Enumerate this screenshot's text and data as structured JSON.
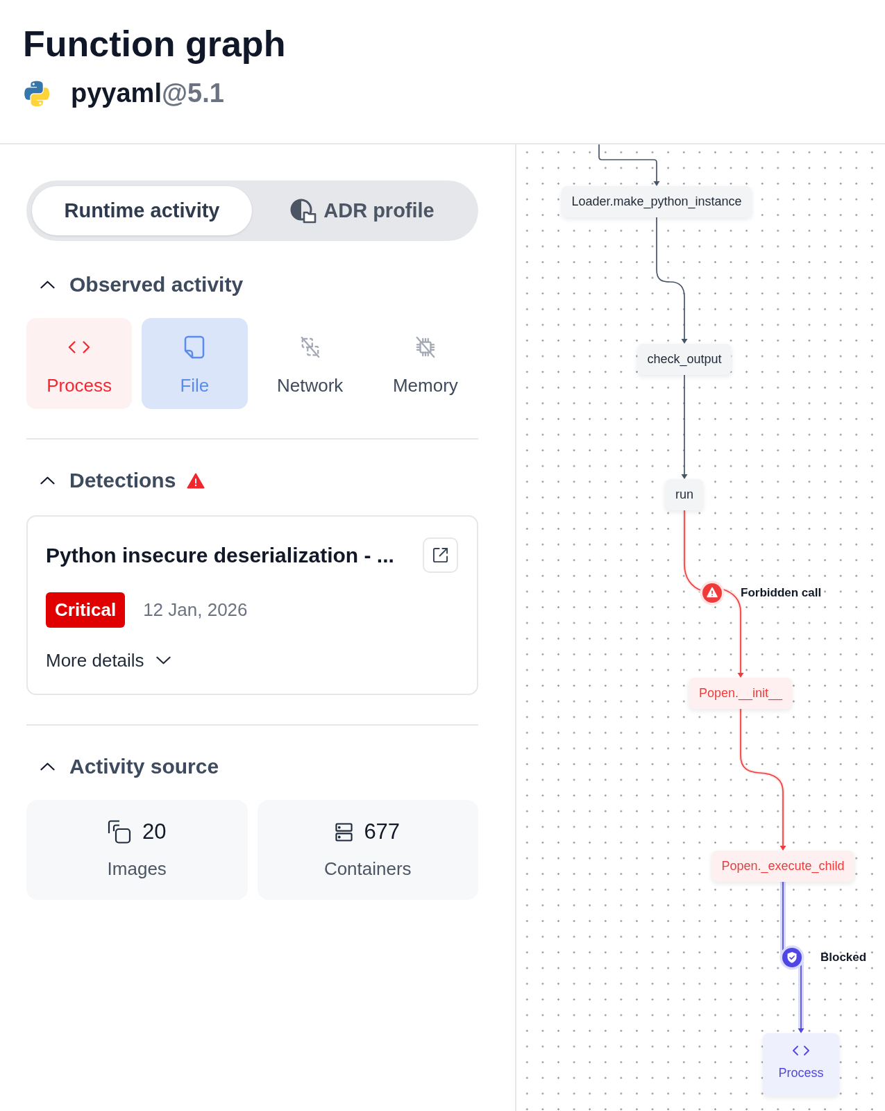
{
  "header": {
    "title": "Function graph",
    "package": {
      "name": "pyyaml",
      "version": "@5.1"
    }
  },
  "tabs": [
    {
      "label": "Runtime activity",
      "selected": true,
      "icon": false
    },
    {
      "label": "ADR profile",
      "selected": false,
      "icon": true
    }
  ],
  "observed_activity": {
    "title": "Observed activity",
    "expanded": true,
    "items": [
      {
        "kind": "process",
        "label": "Process",
        "observed": true,
        "alert": true
      },
      {
        "kind": "file",
        "label": "File",
        "observed": true,
        "alert": false
      },
      {
        "kind": "network",
        "label": "Network",
        "observed": false,
        "alert": false
      },
      {
        "kind": "memory",
        "label": "Memory",
        "observed": false,
        "alert": false
      }
    ]
  },
  "detections": {
    "title": "Detections",
    "alert": true,
    "expanded": true,
    "items": [
      {
        "title": "Python insecure deserialization - ...",
        "severity": {
          "kind": "critical",
          "label": "Critical"
        },
        "date": "12 Jan, 2026",
        "details_label": "More details",
        "details_expanded": false
      }
    ]
  },
  "activity_source": {
    "title": "Activity source",
    "expanded": true,
    "items": [
      {
        "kind": "images",
        "count": "20",
        "label": "Images"
      },
      {
        "kind": "containers",
        "count": "677",
        "label": "Containers"
      }
    ]
  },
  "graph": {
    "nodes": [
      {
        "kind": "function",
        "label": "Loader.make_python_instance",
        "forbidden": false,
        "blocked": false
      },
      {
        "kind": "function",
        "label": "check_output",
        "forbidden": false,
        "blocked": false
      },
      {
        "kind": "function",
        "label": "run",
        "forbidden": false,
        "blocked": false
      },
      {
        "kind": "function",
        "label": "Popen.__init__",
        "forbidden": true,
        "blocked": false
      },
      {
        "kind": "function",
        "label": "Popen._execute_child",
        "forbidden": true,
        "blocked": false
      },
      {
        "kind": "process",
        "label": "Process",
        "forbidden": false,
        "blocked": true
      }
    ],
    "markers": [
      {
        "kind": "forbidden",
        "label": "Forbidden call"
      },
      {
        "kind": "blocked",
        "label": "Blocked"
      }
    ]
  }
}
